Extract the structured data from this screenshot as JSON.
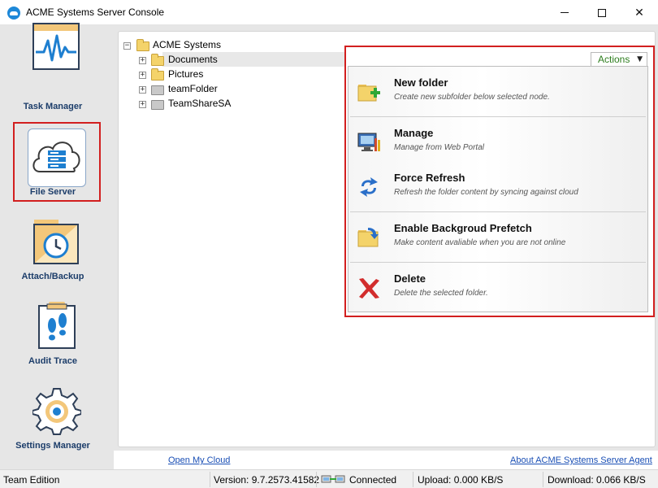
{
  "window": {
    "title": "ACME Systems Server Console"
  },
  "nav": {
    "items": [
      {
        "label": "Task Manager",
        "icon": "pulse-monitor-icon"
      },
      {
        "label": "File Server",
        "icon": "cloud-server-icon",
        "selected": true
      },
      {
        "label": "Attach/Backup",
        "icon": "clock-folder-icon"
      },
      {
        "label": "Audit Trace",
        "icon": "footprints-clipboard-icon"
      },
      {
        "label": "Settings Manager",
        "icon": "gear-icon"
      }
    ]
  },
  "tree": {
    "root": "ACME Systems",
    "children": [
      {
        "label": "Documents",
        "type": "folder",
        "selected": true
      },
      {
        "label": "Pictures",
        "type": "folder"
      },
      {
        "label": "teamFolder",
        "type": "shared"
      },
      {
        "label": "TeamShareSA",
        "type": "shared"
      }
    ]
  },
  "actions": {
    "button_label": "Actions",
    "items": [
      {
        "title": "New folder",
        "desc": "Create new subfolder below selected node.",
        "icon": "new-folder-icon"
      },
      {
        "title": "Manage",
        "desc": "Manage from Web Portal",
        "icon": "manage-monitor-icon"
      },
      {
        "title": "Force Refresh",
        "desc": "Refresh the folder content by syncing against cloud",
        "icon": "refresh-arrows-icon"
      },
      {
        "title": "Enable Backgroud Prefetch",
        "desc": "Make content avaliable when you are not online",
        "icon": "prefetch-folder-icon"
      },
      {
        "title": "Delete",
        "desc": "Delete the selected folder.",
        "icon": "delete-x-icon"
      }
    ]
  },
  "links": {
    "open_cloud": "Open My Cloud",
    "about": "About ACME Systems Server Agent"
  },
  "status": {
    "edition": "Team Edition",
    "version": "Version: 9.7.2573.41582",
    "connection": "Connected",
    "upload": "Upload: 0.000 KB/S",
    "download": "Download: 0.066 KB/S"
  },
  "colors": {
    "highlight_border": "#d21f1f",
    "nav_label": "#1c3d6a",
    "actions_text": "#2d7d1e",
    "link": "#1a4fb5"
  }
}
